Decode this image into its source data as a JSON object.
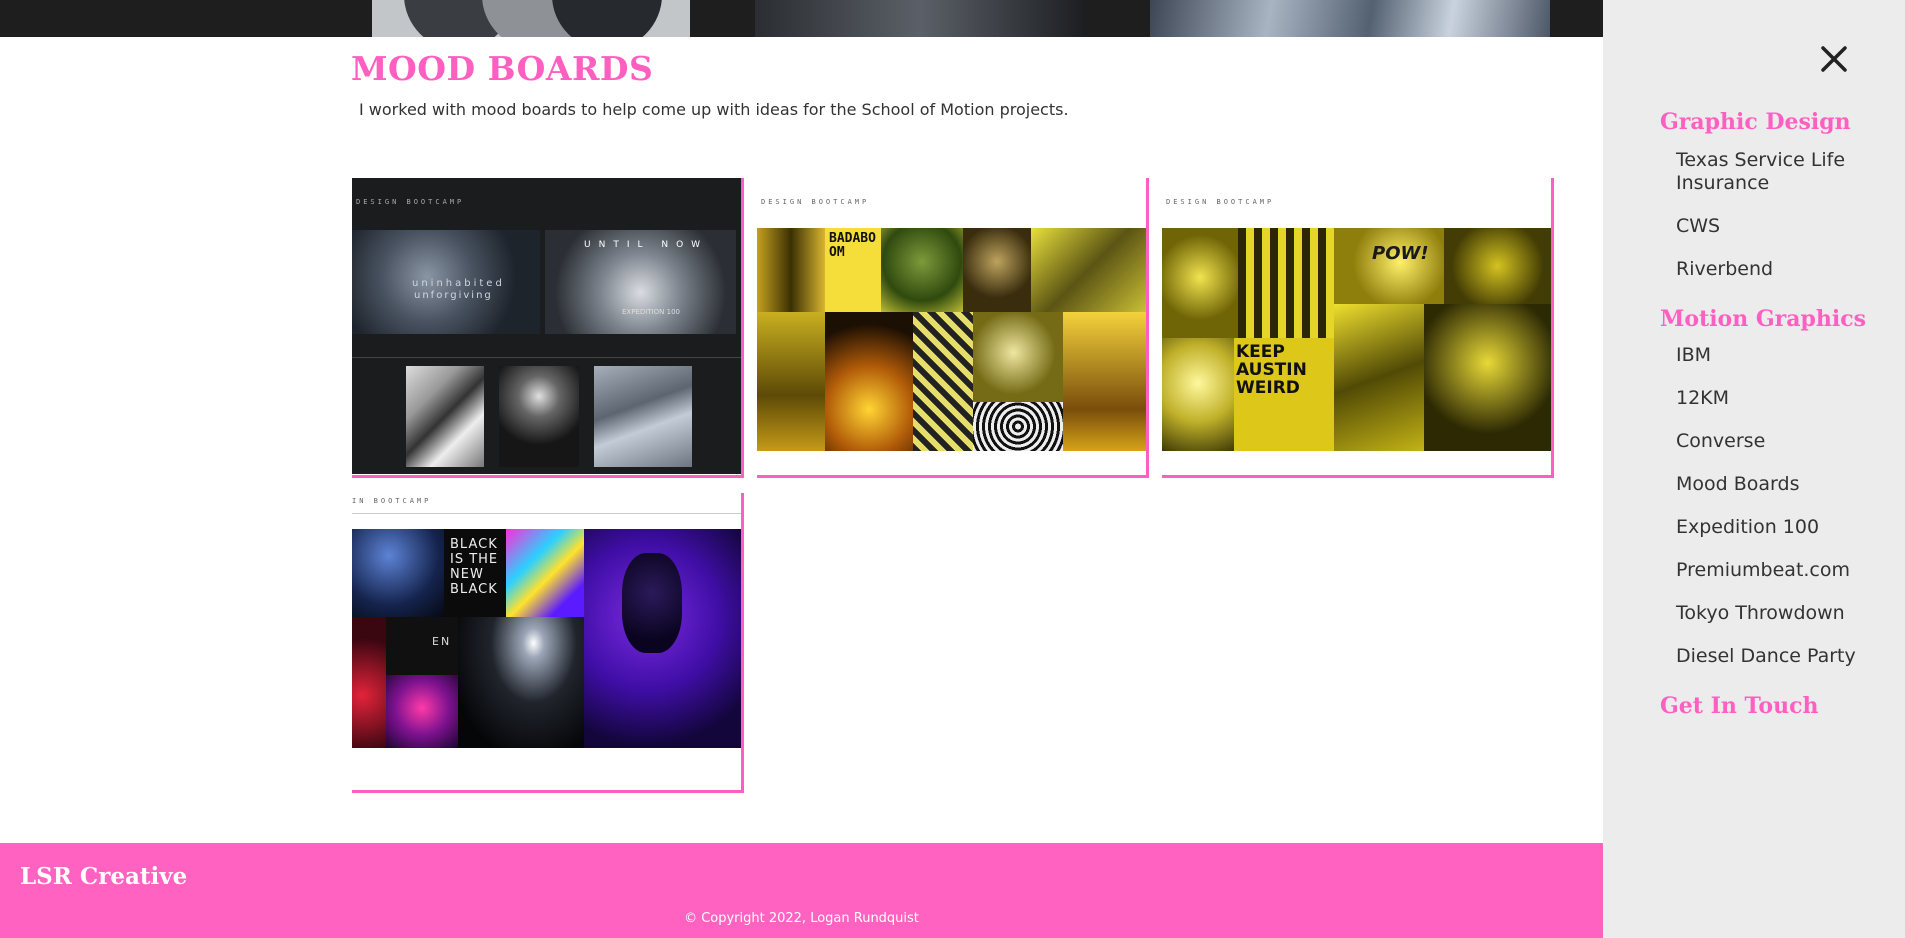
{
  "page": {
    "title": "MOOD BOARDS",
    "intro": "I worked with mood boards to help come up with ideas for the School of Motion projects."
  },
  "gallery": {
    "items": [
      {
        "id": "board-1",
        "header_text": "DESIGN BOOTCAMP",
        "overlay_text_1": "uninhabited",
        "overlay_text_2": "unforgiving",
        "overlay_text_3": "UNTIL NOW",
        "overlay_text_4": "EXPEDITION 100",
        "tone": "dark-blue-grey"
      },
      {
        "id": "board-2",
        "header_text": "DESIGN BOOTCAMP",
        "overlay_text_1": "BADABOOM",
        "tone": "yellow-black"
      },
      {
        "id": "board-3",
        "header_text": "DESIGN BOOTCAMP",
        "overlay_text_1": "KEEP AUSTIN WEIRD",
        "overlay_text_2": "POW!",
        "tone": "yellow"
      },
      {
        "id": "board-4",
        "header_text": "IN BOOTCAMP",
        "overlay_text_1": "BLACK IS THE NEW BLACK",
        "overlay_text_2": "EN",
        "tone": "neon"
      }
    ]
  },
  "sidebar": {
    "close_icon": "close-icon",
    "sections": [
      {
        "title": "Graphic Design",
        "items": [
          "Texas Service Life Insurance",
          "CWS",
          "Riverbend"
        ]
      },
      {
        "title": "Motion Graphics",
        "items": [
          "IBM",
          "12KM",
          "Converse",
          "Mood Boards",
          "Expedition 100",
          "Premiumbeat.com",
          "Tokyo Throwdown",
          "Diesel Dance Party"
        ]
      },
      {
        "title": "Get In Touch",
        "items": []
      }
    ]
  },
  "footer": {
    "brand": "LSR Creative",
    "copyright": "© Copyright 2022, Logan Rundquist"
  },
  "colors": {
    "accent": "#ff5fc0",
    "footer_bg": "#ff62c0",
    "sidebar_bg": "#ececec"
  }
}
